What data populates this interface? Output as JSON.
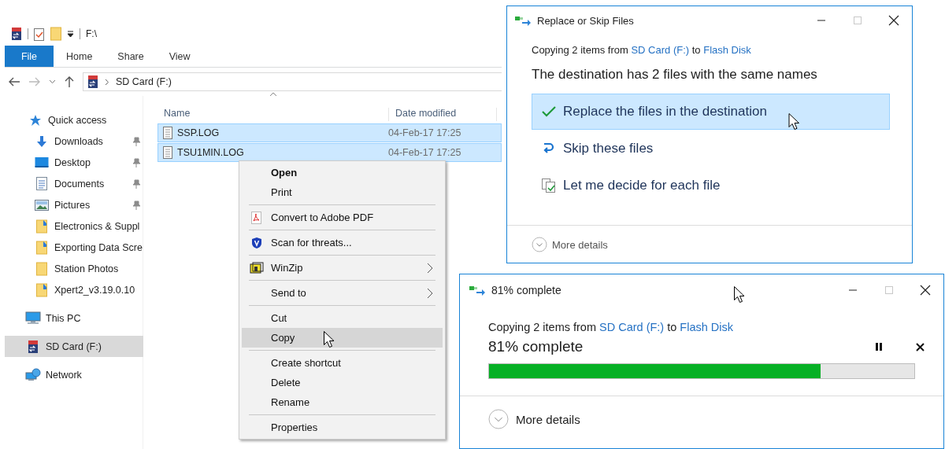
{
  "explorer": {
    "qat_path": "F:\\",
    "ribbon_tabs": [
      {
        "label": "File",
        "kind": "menu"
      },
      {
        "label": "Home",
        "kind": "tab"
      },
      {
        "label": "Share",
        "kind": "tab"
      },
      {
        "label": "View",
        "kind": "tab"
      }
    ],
    "address": "SD Card (F:)",
    "sidebar": [
      {
        "label": "Quick access",
        "selected": false,
        "children": [
          {
            "label": "Downloads",
            "pinned": true,
            "selected": false
          },
          {
            "label": "Desktop",
            "pinned": true,
            "selected": false
          },
          {
            "label": "Documents",
            "pinned": true,
            "selected": false
          },
          {
            "label": "Pictures",
            "pinned": true,
            "selected": false
          },
          {
            "label": "Electronics & Suppl",
            "pinned": false,
            "selected": false
          },
          {
            "label": "Exporting Data Scre",
            "pinned": false,
            "selected": false
          },
          {
            "label": "Station Photos",
            "pinned": false,
            "selected": false
          },
          {
            "label": "Xpert2_v3.19.0.10",
            "pinned": false,
            "selected": false
          }
        ]
      },
      {
        "label": "This PC",
        "selected": false
      },
      {
        "label": "SD Card (F:)",
        "selected": true
      },
      {
        "label": "Network",
        "selected": false
      }
    ],
    "columns": [
      "Name",
      "Date modified"
    ],
    "files": [
      {
        "name": "SSP.LOG",
        "date": "04-Feb-17 17:25",
        "selected": true
      },
      {
        "name": "TSU1MIN.LOG",
        "date": "04-Feb-17 17:25",
        "selected": true
      }
    ]
  },
  "context_menu": [
    {
      "kind": "item",
      "label": "Open",
      "default": true,
      "submenu": false,
      "selected": false
    },
    {
      "kind": "item",
      "label": "Print",
      "default": false,
      "submenu": false,
      "selected": false
    },
    {
      "kind": "separator"
    },
    {
      "kind": "item",
      "label": "Convert to Adobe PDF",
      "default": false,
      "submenu": false,
      "selected": false
    },
    {
      "kind": "separator"
    },
    {
      "kind": "item",
      "label": "Scan for threats...",
      "default": false,
      "submenu": false,
      "selected": false
    },
    {
      "kind": "separator"
    },
    {
      "kind": "item",
      "label": "WinZip",
      "default": false,
      "submenu": true,
      "selected": false
    },
    {
      "kind": "separator"
    },
    {
      "kind": "item",
      "label": "Send to",
      "default": false,
      "submenu": true,
      "selected": false
    },
    {
      "kind": "separator"
    },
    {
      "kind": "item",
      "label": "Cut",
      "default": false,
      "submenu": false,
      "selected": false
    },
    {
      "kind": "item",
      "label": "Copy",
      "default": false,
      "submenu": false,
      "selected": true
    },
    {
      "kind": "separator"
    },
    {
      "kind": "item",
      "label": "Create shortcut",
      "default": false,
      "submenu": false,
      "selected": false
    },
    {
      "kind": "item",
      "label": "Delete",
      "default": false,
      "submenu": false,
      "selected": false
    },
    {
      "kind": "item",
      "label": "Rename",
      "default": false,
      "submenu": false,
      "selected": false
    },
    {
      "kind": "separator"
    },
    {
      "kind": "item",
      "label": "Properties",
      "default": false,
      "submenu": false,
      "selected": false
    }
  ],
  "replace_dialog": {
    "title": "Replace or Skip Files",
    "copying": {
      "text_before": "Copying 2 items from ",
      "source": "SD Card (F:)",
      "text_middle": " to ",
      "destination": "Flash Disk"
    },
    "heading": "The destination has 2 files with the same names",
    "options": [
      {
        "label": "Replace the files in the destination",
        "selected": true
      },
      {
        "label": "Skip these files",
        "selected": false
      },
      {
        "label": "Let me decide for each file",
        "selected": false
      }
    ],
    "more_details": "More details"
  },
  "progress_dialog": {
    "title": "81% complete",
    "copying": {
      "text_before": "Copying 2 items from ",
      "source": "SD Card (F:)",
      "text_middle": " to ",
      "destination": "Flash Disk"
    },
    "status": "81% complete",
    "level": 0.78,
    "more_details": "More details"
  }
}
